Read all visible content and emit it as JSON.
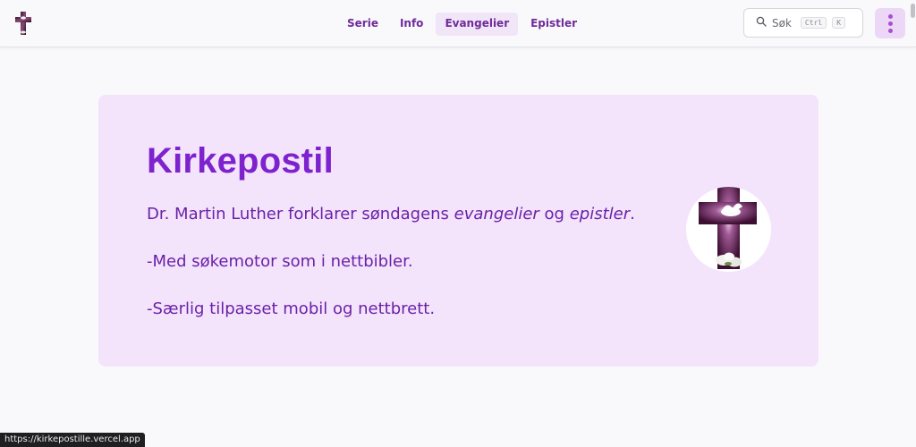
{
  "nav": {
    "items": [
      {
        "label": "Serie",
        "active": false
      },
      {
        "label": "Info",
        "active": false
      },
      {
        "label": "Evangelier",
        "active": true
      },
      {
        "label": "Epistler",
        "active": false
      }
    ]
  },
  "search": {
    "placeholder": "Søk",
    "shortcut": [
      "Ctrl",
      "K"
    ]
  },
  "hero": {
    "title": "Kirkepostil",
    "line1_a": "Dr. Martin Luther forklarer søndagens ",
    "line1_em1": "evangelier",
    "line1_b": " og ",
    "line1_em2": "epistler",
    "line1_c": ".",
    "line2": "-Med søkemotor som i nettbibler.",
    "line3": "-Særlig tilpasset mobil og nettbrett."
  },
  "statusbar": {
    "url": "https://kirkepostille.vercel.app"
  },
  "colors": {
    "accent": "#7e22ce",
    "hero_bg": "#f3e4fc",
    "text_purple": "#6b21a8"
  },
  "icons": [
    "cross-logo-icon",
    "search-icon",
    "more-vertical-icon",
    "cross-dove-image"
  ]
}
